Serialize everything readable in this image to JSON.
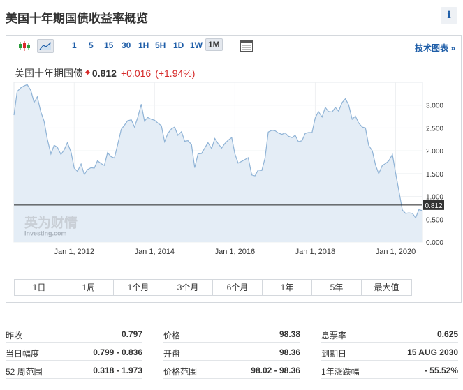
{
  "page_title": "美国十年期国债收益率概览",
  "info_icon": "i",
  "toolbar": {
    "icons": [
      "candlestick-chart-icon",
      "area-chart-icon",
      "table-icon"
    ],
    "intervals": [
      "1",
      "5",
      "15",
      "30",
      "1H",
      "5H",
      "1D",
      "1W",
      "1M"
    ],
    "active_interval": "1M",
    "tech_link": "技术图表 »"
  },
  "quote": {
    "name": "美国十年期国债",
    "price": "0.812",
    "change": "+0.016",
    "change_pct": "(+1.94%)",
    "up_color": "#d62a2a"
  },
  "watermark": {
    "brand": "英为财情",
    "sub": "Investing.com"
  },
  "chart_data": {
    "type": "area",
    "x_ticks": [
      "Jan 1, 2012",
      "Jan 1, 2014",
      "Jan 1, 2016",
      "Jan 1, 2018",
      "Jan 1, 2020"
    ],
    "y_ticks": [
      "3.000",
      "2.500",
      "2.000",
      "1.500",
      "1.000",
      "0.500",
      "0.000"
    ],
    "ylim": [
      0,
      3.5
    ],
    "xlim": [
      2010.5,
      2020.67
    ],
    "last_value_label": "0.812",
    "line_color": "#8fb3d6",
    "fill_color": "#e4edf6",
    "x": [
      2010.5,
      2010.58,
      2010.67,
      2010.75,
      2010.83,
      2010.92,
      2011.0,
      2011.08,
      2011.17,
      2011.25,
      2011.33,
      2011.42,
      2011.5,
      2011.58,
      2011.67,
      2011.75,
      2011.83,
      2011.92,
      2012.0,
      2012.08,
      2012.17,
      2012.25,
      2012.33,
      2012.42,
      2012.5,
      2012.58,
      2012.67,
      2012.75,
      2012.83,
      2012.92,
      2013.0,
      2013.08,
      2013.17,
      2013.25,
      2013.33,
      2013.42,
      2013.5,
      2013.58,
      2013.67,
      2013.75,
      2013.83,
      2013.92,
      2014.0,
      2014.08,
      2014.17,
      2014.25,
      2014.33,
      2014.42,
      2014.5,
      2014.58,
      2014.67,
      2014.75,
      2014.83,
      2014.92,
      2015.0,
      2015.08,
      2015.17,
      2015.25,
      2015.33,
      2015.42,
      2015.5,
      2015.58,
      2015.67,
      2015.75,
      2015.83,
      2015.92,
      2016.0,
      2016.08,
      2016.17,
      2016.25,
      2016.33,
      2016.42,
      2016.5,
      2016.58,
      2016.67,
      2016.75,
      2016.83,
      2016.92,
      2017.0,
      2017.08,
      2017.17,
      2017.25,
      2017.33,
      2017.42,
      2017.5,
      2017.58,
      2017.67,
      2017.75,
      2017.83,
      2017.92,
      2018.0,
      2018.08,
      2018.17,
      2018.25,
      2018.33,
      2018.42,
      2018.5,
      2018.58,
      2018.67,
      2018.75,
      2018.83,
      2018.92,
      2019.0,
      2019.08,
      2019.17,
      2019.25,
      2019.33,
      2019.42,
      2019.5,
      2019.58,
      2019.67,
      2019.75,
      2019.83,
      2019.92,
      2020.0,
      2020.08,
      2020.17,
      2020.25,
      2020.33,
      2020.42,
      2020.5,
      2020.58,
      2020.67
    ],
    "values": [
      2.78,
      3.3,
      3.38,
      3.42,
      3.45,
      3.32,
      3.06,
      3.18,
      2.85,
      2.65,
      2.26,
      1.93,
      2.12,
      2.08,
      1.92,
      2.02,
      2.18,
      1.97,
      1.62,
      1.55,
      1.71,
      1.48,
      1.59,
      1.63,
      1.62,
      1.78,
      1.72,
      1.68,
      1.96,
      1.87,
      1.84,
      2.13,
      2.47,
      2.56,
      2.66,
      2.68,
      2.52,
      2.73,
      3.02,
      2.65,
      2.73,
      2.69,
      2.67,
      2.61,
      2.55,
      2.2,
      2.38,
      2.48,
      2.52,
      2.34,
      2.42,
      2.21,
      2.22,
      2.14,
      1.63,
      1.93,
      1.94,
      2.06,
      2.18,
      2.05,
      2.27,
      2.16,
      2.06,
      2.16,
      2.23,
      2.29,
      1.93,
      1.73,
      1.77,
      1.81,
      1.85,
      1.47,
      1.45,
      1.58,
      1.57,
      1.84,
      2.41,
      2.45,
      2.44,
      2.39,
      2.36,
      2.39,
      2.32,
      2.29,
      2.34,
      2.2,
      2.22,
      2.38,
      2.4,
      2.4,
      2.72,
      2.86,
      2.74,
      2.95,
      2.86,
      2.85,
      2.95,
      2.87,
      3.06,
      3.14,
      3.01,
      2.69,
      2.76,
      2.61,
      2.52,
      2.5,
      2.12,
      2.0,
      1.69,
      1.5,
      1.68,
      1.72,
      1.78,
      1.92,
      1.51,
      1.13,
      0.7,
      0.63,
      0.64,
      0.63,
      0.53,
      0.71,
      0.69,
      0.72,
      0.81
    ],
    "current": 0.812
  },
  "time_ranges": [
    "1日",
    "1周",
    "1个月",
    "3个月",
    "6个月",
    "1年",
    "5年",
    "最大值"
  ],
  "stats": [
    [
      {
        "label": "昨收",
        "value": "0.797"
      },
      {
        "label": "价格",
        "value": "98.38"
      },
      {
        "label": "息票率",
        "value": "0.625"
      }
    ],
    [
      {
        "label": "当日幅度",
        "value": "0.799 - 0.836"
      },
      {
        "label": "开盘",
        "value": "98.36"
      },
      {
        "label": "到期日",
        "value": "15 AUG 2030"
      }
    ],
    [
      {
        "label": "52 周范围",
        "value": "0.318 - 1.973"
      },
      {
        "label": "价格范围",
        "value": "98.02 - 98.36"
      },
      {
        "label": "1年涨跌幅",
        "value": "- 55.52%"
      }
    ]
  ]
}
